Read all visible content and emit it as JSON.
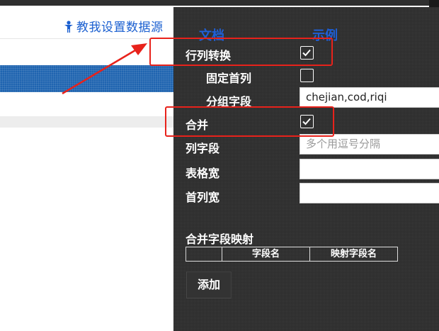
{
  "page": {
    "help_link": "教我设置数据源",
    "help_icon": "person-icon"
  },
  "panel": {
    "tabs": {
      "doc": "文档",
      "example": "示例"
    },
    "fields": {
      "transpose": {
        "label": "行列转换",
        "checked": true
      },
      "fix_first_col": {
        "label": "固定首列",
        "checked": false
      },
      "group_field": {
        "label": "分组字段",
        "value": "chejian,cod,riqi"
      },
      "merge": {
        "label": "合并",
        "checked": true
      },
      "col_field": {
        "label": "列字段",
        "placeholder": "多个用逗号分隔"
      },
      "table_width": {
        "label": "表格宽",
        "value": ""
      },
      "first_col_width": {
        "label": "首列宽",
        "value": ""
      }
    },
    "mapping": {
      "title": "合并字段映射",
      "columns": [
        "",
        "字段名",
        "映射字段名"
      ]
    },
    "add_button": "添加"
  },
  "annotation": {
    "color": "#e8221b"
  },
  "colors": {
    "panel_bg": "#3c3c3c",
    "tab_blue": "#1e5fd6",
    "link_blue": "#1a5fd0",
    "band_blue": "#1f64b0"
  }
}
